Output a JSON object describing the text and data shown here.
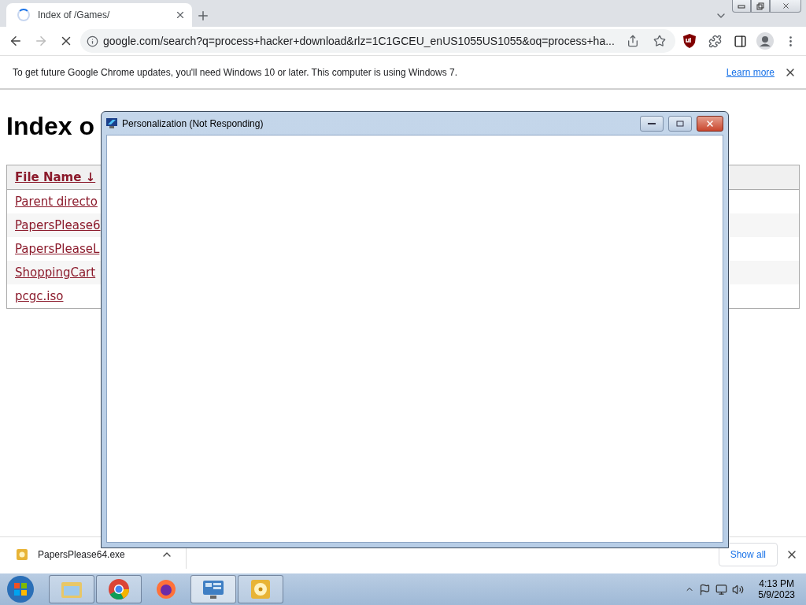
{
  "browser": {
    "tab": {
      "title": "Index of /Games/",
      "loading": true
    },
    "address": "google.com/search?q=process+hacker+download&rlz=1C1GCEU_enUS1055US1055&oq=process+ha...",
    "infobar": {
      "message": "To get future Google Chrome updates, you'll need Windows 10 or later. This computer is using Windows 7.",
      "link": "Learn more"
    },
    "page": {
      "heading": "Index o",
      "table": {
        "columns": [
          {
            "label": "File Name ↓"
          }
        ],
        "rows": [
          "Parent directo",
          "PapersPlease6",
          "PapersPleaseL",
          "ShoppingCart",
          "pcgc.iso"
        ]
      }
    },
    "downloads": {
      "items": [
        {
          "name": "PapersPlease64.exe"
        }
      ],
      "show_all": "Show all"
    }
  },
  "dialog": {
    "title": "Personalization (Not Responding)"
  },
  "taskbar": {
    "items": [
      {
        "kind": "explorer",
        "selected": false
      },
      {
        "kind": "chrome",
        "selected": false
      },
      {
        "kind": "firefox",
        "selected": false
      },
      {
        "kind": "control-panel",
        "selected": true
      },
      {
        "kind": "disc",
        "selected": false
      }
    ],
    "clock": {
      "time": "4:13 PM",
      "date": "5/9/2023"
    }
  }
}
